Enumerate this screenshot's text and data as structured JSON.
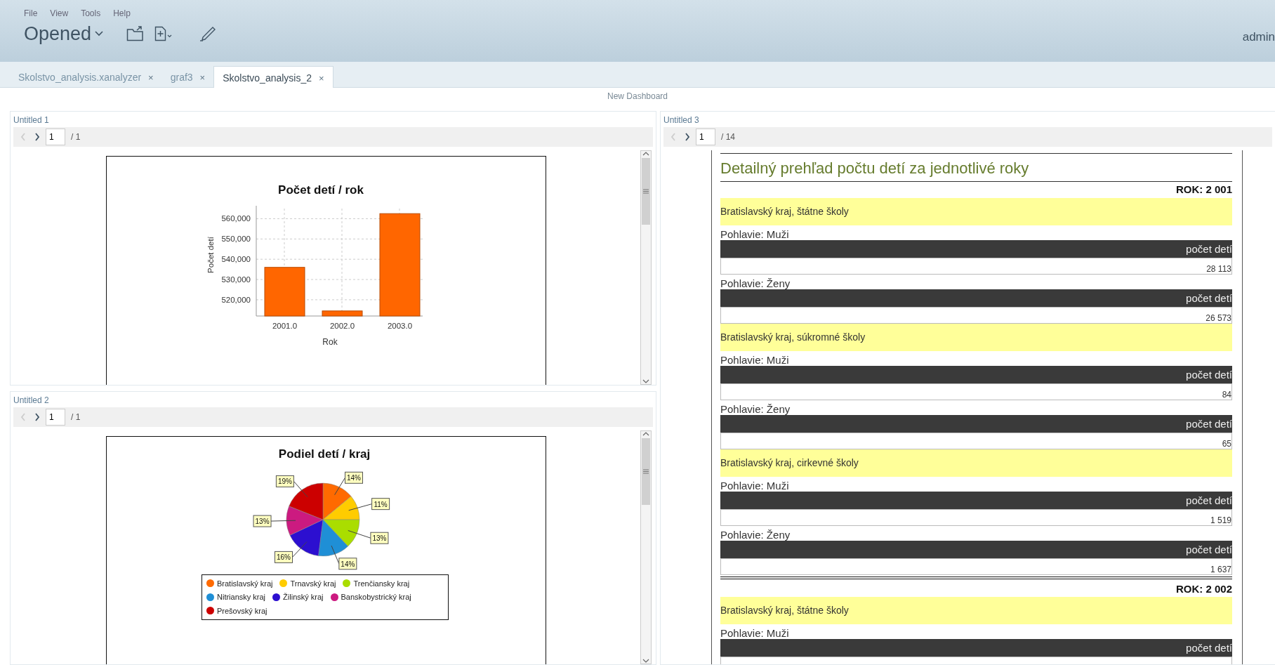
{
  "menu": [
    "File",
    "View",
    "Tools",
    "Help"
  ],
  "toolbar": {
    "title": "Opened",
    "user": "admin"
  },
  "tabs": [
    {
      "label": "Skolstvo_analysis.xanalyzer",
      "close": "×",
      "selected": false
    },
    {
      "label": "graf3",
      "close": "×",
      "selected": false
    },
    {
      "label": "Skolstvo_analysis_2",
      "close": "×",
      "selected": true
    }
  ],
  "dashboard_title": "New Dashboard",
  "panels": [
    {
      "title": "Untitled 1",
      "kind": "chart",
      "pager": {
        "page": "1",
        "total": "/ 1",
        "prev_disabled": true
      },
      "chart_data": {
        "type": "bar",
        "title": "Počet detí / rok",
        "xlabel": "Rok",
        "ylabel": "Počet detí",
        "categories": [
          "2001.0",
          "2002.0",
          "2003.0"
        ],
        "values": [
          536000,
          514500,
          562500
        ],
        "grid": true,
        "ylim": [
          512000,
          565000
        ],
        "yticks": [
          {
            "value": 520000,
            "label": "520,000"
          },
          {
            "value": 530000,
            "label": "530,000"
          },
          {
            "value": 540000,
            "label": "540,000"
          },
          {
            "value": 550000,
            "label": "550,000"
          },
          {
            "value": 560000,
            "label": "560,000"
          }
        ]
      }
    },
    {
      "title": "Untitled 2",
      "kind": "chart",
      "pager": {
        "page": "1",
        "total": "/ 1",
        "prev_disabled": true
      },
      "chart_data": {
        "type": "pie",
        "title": "Podiel detí / kraj",
        "categories": [
          "Bratislavský kraj",
          "Trnavský kraj",
          "Trenčiansky kraj",
          "Nitriansky kraj",
          "Žilinský kraj",
          "Banskobystrický kraj",
          "Prešovský kraj"
        ],
        "values": [
          14,
          11,
          13,
          14,
          16,
          13,
          19
        ],
        "value_labels": [
          "14%",
          "11%",
          "13%",
          "14%",
          "16%",
          "13%",
          "19%"
        ]
      },
      "legend": [
        {
          "color": "#ff6a00"
        },
        {
          "color": "#ffcc00"
        },
        {
          "color": "#aadd00"
        },
        {
          "color": "#1f8fd6"
        },
        {
          "color": "#2c0fd0"
        },
        {
          "color": "#cc1a80"
        },
        {
          "color": "#cc0000"
        }
      ]
    },
    {
      "title": "Untitled 3",
      "kind": "report",
      "pager": {
        "page": "1",
        "total": "/ 14",
        "prev_disabled": true
      },
      "report": {
        "title": "Detailný prehľad počtu detí za jednotlivé roky",
        "years": [
          {
            "label": "ROK: 2 001",
            "sections": [
              {
                "heading": "Bratislavský kraj, štátne školy",
                "rows": [
                  {
                    "label": "Pohlavie: Muži",
                    "column": "počet detí",
                    "value": "28 113"
                  },
                  {
                    "label": "Pohlavie: Ženy",
                    "column": "počet detí",
                    "value": "26 573"
                  }
                ]
              },
              {
                "heading": "Bratislavský kraj, súkromné školy",
                "rows": [
                  {
                    "label": "Pohlavie: Muži",
                    "column": "počet detí",
                    "value": "84"
                  },
                  {
                    "label": "Pohlavie: Ženy",
                    "column": "počet detí",
                    "value": "65"
                  }
                ]
              },
              {
                "heading": "Bratislavský kraj, cirkevné školy",
                "rows": [
                  {
                    "label": "Pohlavie: Muži",
                    "column": "počet detí",
                    "value": "1 519"
                  },
                  {
                    "label": "Pohlavie: Ženy",
                    "column": "počet detí",
                    "value": "1 637"
                  }
                ]
              }
            ]
          },
          {
            "label": "ROK: 2 002",
            "sections": [
              {
                "heading": "Bratislavský kraj, štátne školy",
                "rows": [
                  {
                    "label": "Pohlavie: Muži",
                    "column": "počet detí"
                  }
                ]
              }
            ]
          }
        ]
      }
    }
  ]
}
